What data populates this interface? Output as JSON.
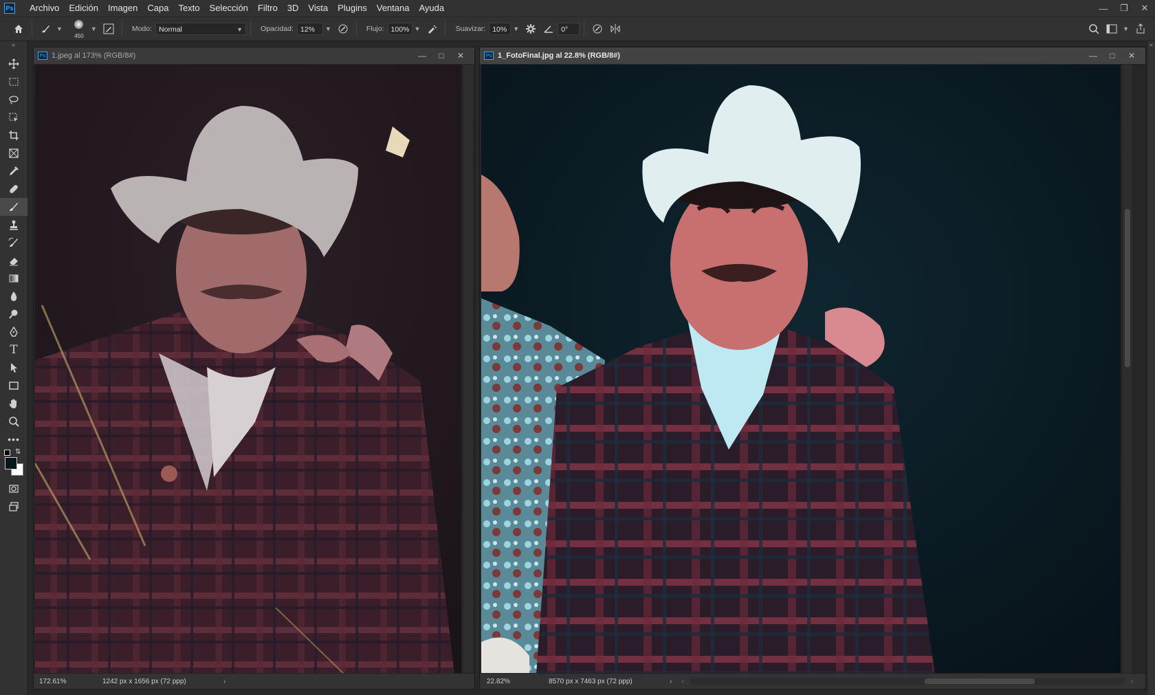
{
  "menu": {
    "logo": "Ps",
    "items": [
      "Archivo",
      "Edición",
      "Imagen",
      "Capa",
      "Texto",
      "Selección",
      "Filtro",
      "3D",
      "Vista",
      "Plugins",
      "Ventana",
      "Ayuda"
    ]
  },
  "options": {
    "brush_size": "450",
    "modo_label": "Modo:",
    "modo_value": "Normal",
    "opacidad_label": "Opacidad:",
    "opacidad_value": "12%",
    "flujo_label": "Flujo:",
    "flujo_value": "100%",
    "suavizar_label": "Suavizar:",
    "suavizar_value": "10%",
    "angle_value": "0°"
  },
  "doc_left": {
    "badge": "Ps",
    "title": "1.jpeg al 173% (RGB/8#)",
    "zoom": "172.61%",
    "size": "1242 px x 1656 px (72 ppp)"
  },
  "doc_right": {
    "badge": "Ps",
    "title": "1_FotoFinal.jpg al 22.8% (RGB/8#)",
    "zoom": "22.82%",
    "size": "8570 px x 7463 px (72 ppp)"
  },
  "colors": {
    "accent": "#31a8ff",
    "ui_bg": "#323232",
    "canvas_bg": "#262626"
  },
  "icons": {
    "tools": [
      "move-icon",
      "marquee-icon",
      "lasso-icon",
      "object-select-icon",
      "crop-icon",
      "frame-icon",
      "eyedropper-icon",
      "healing-brush-icon",
      "brush-icon",
      "clone-stamp-icon",
      "history-brush-icon",
      "eraser-icon",
      "gradient-icon",
      "blur-icon",
      "dodge-icon",
      "pen-icon",
      "type-icon",
      "path-select-icon",
      "rectangle-icon",
      "hand-icon",
      "zoom-icon",
      "more-tools-icon"
    ]
  }
}
